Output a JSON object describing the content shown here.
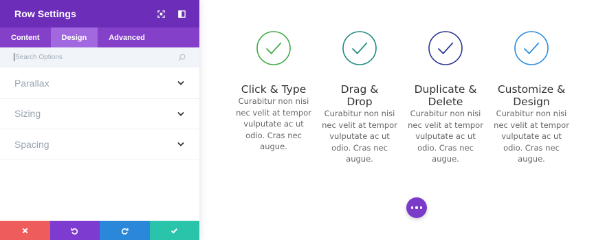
{
  "panel": {
    "title": "Row Settings",
    "header_icons": [
      "fullscreen-icon",
      "sidebar-toggle-icon"
    ],
    "tabs": [
      {
        "label": "Content",
        "active": false
      },
      {
        "label": "Design",
        "active": true
      },
      {
        "label": "Advanced",
        "active": false
      }
    ],
    "search": {
      "placeholder": "Search Options",
      "value": ""
    },
    "sections": [
      {
        "label": "Parallax"
      },
      {
        "label": "Sizing"
      },
      {
        "label": "Spacing"
      }
    ],
    "footer_buttons": [
      {
        "name": "cancel",
        "icon": "close-icon",
        "color": "#ef5c5c"
      },
      {
        "name": "undo",
        "icon": "undo-icon",
        "color": "#7e3bd0"
      },
      {
        "name": "redo",
        "icon": "redo-icon",
        "color": "#2b87da"
      },
      {
        "name": "save",
        "icon": "check-icon",
        "color": "#29c4a9"
      }
    ],
    "colors": {
      "header": "#6c2eb9",
      "tabs": "#8540c9",
      "active_tab": "#a168df"
    }
  },
  "features": [
    {
      "title": "Click & Type",
      "body": "Curabitur non nisi nec velit at tempor vulputate ac ut odio. Cras nec augue.",
      "icon": "check-circle-icon",
      "color": "#3fab43"
    },
    {
      "title": "Drag & Drop",
      "body": "Curabitur non nisi nec velit at tempor vulputate ac ut odio. Cras nec augue.",
      "icon": "check-circle-icon",
      "color": "#1f8a7d"
    },
    {
      "title": "Duplicate & Delete",
      "body": "Curabitur non nisi nec velit at tempor vulputate ac ut odio. Cras nec augue.",
      "icon": "check-circle-icon",
      "color": "#2b3490"
    },
    {
      "title": "Customize & Design",
      "body": "Curabitur non nisi nec velit at tempor vulputate ac ut odio. Cras nec augue.",
      "icon": "check-circle-icon",
      "color": "#2b8cde"
    }
  ],
  "more_button": {
    "icon": "more-dots-icon",
    "color": "#7b3bc9"
  }
}
